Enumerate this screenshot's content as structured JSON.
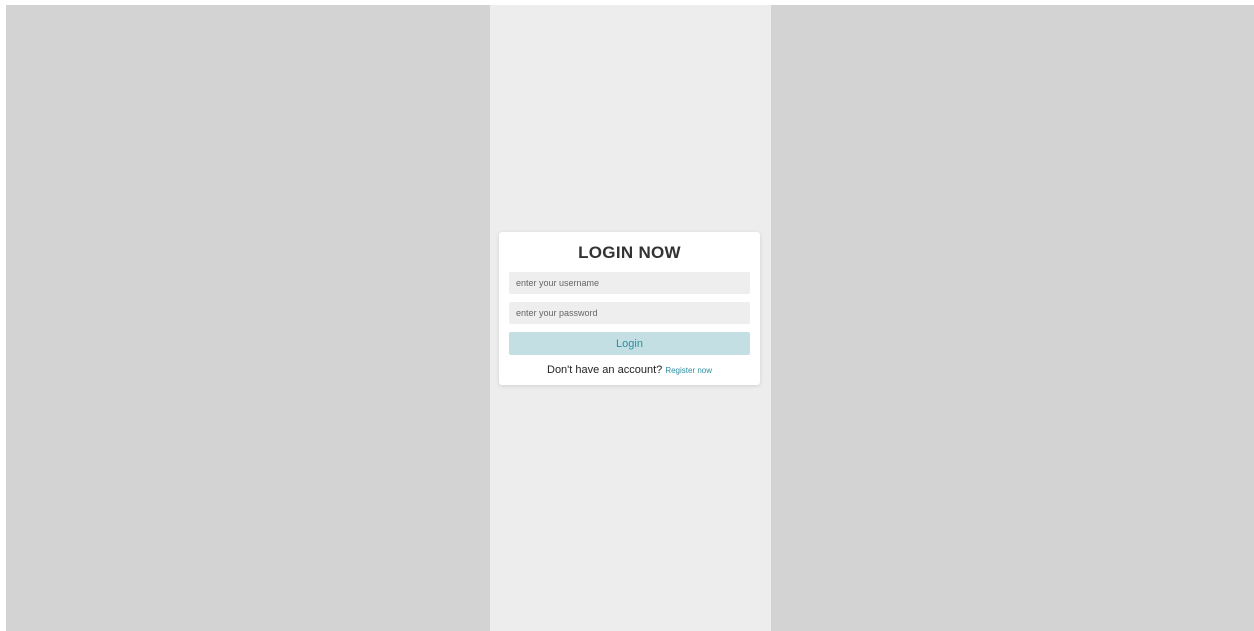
{
  "login": {
    "title": "LOGIN NOW",
    "username_placeholder": "enter your username",
    "password_placeholder": "enter your password",
    "button_label": "Login",
    "register_prompt": "Don't have an account?",
    "register_link": "Register now"
  },
  "colors": {
    "page_background": "#d3d3d3",
    "column_background": "#ededed",
    "card_background": "#ffffff",
    "input_background": "#eeeeee",
    "button_background": "#c4dfe4",
    "accent": "#2c8ea0"
  }
}
